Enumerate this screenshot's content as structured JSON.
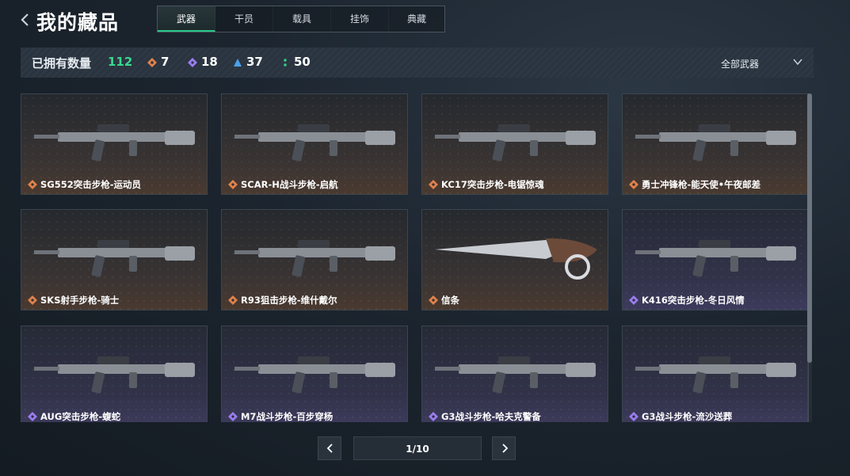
{
  "header": {
    "title": "我的藏品",
    "tabs": [
      {
        "label": "武器",
        "active": true
      },
      {
        "label": "干员",
        "active": false
      },
      {
        "label": "载具",
        "active": false
      },
      {
        "label": "挂饰",
        "active": false
      },
      {
        "label": "典藏",
        "active": false
      }
    ]
  },
  "stats": {
    "owned_label": "已拥有数量",
    "owned_count": "112",
    "rarity_counts": [
      {
        "icon": "orange-diamond-icon",
        "color": "#e0824a",
        "count": "7"
      },
      {
        "icon": "purple-diamond-icon",
        "color": "#9a7cf0",
        "count": "18"
      },
      {
        "icon": "blue-triangle-icon",
        "color": "#4a9fe8",
        "count": "37"
      },
      {
        "icon": "green-dots-icon",
        "color": "#34d08a",
        "count": "50"
      }
    ],
    "filter_label": "全部武器"
  },
  "items": [
    {
      "name": "SG552突击步枪-运动员",
      "rarity": "orange"
    },
    {
      "name": "SCAR-H战斗步枪-启航",
      "rarity": "orange"
    },
    {
      "name": "KC17突击步枪-电锯惊魂",
      "rarity": "orange"
    },
    {
      "name": "勇士冲锋枪-能天使•午夜邮差",
      "rarity": "orange"
    },
    {
      "name": "SKS射手步枪-骑士",
      "rarity": "orange"
    },
    {
      "name": "R93狙击步枪-维什戴尔",
      "rarity": "orange"
    },
    {
      "name": "信条",
      "rarity": "orange"
    },
    {
      "name": "K416突击步枪-冬日风情",
      "rarity": "purple"
    },
    {
      "name": "AUG突击步枪-蝮蛇",
      "rarity": "purple"
    },
    {
      "name": "M7战斗步枪-百步穿杨",
      "rarity": "purple"
    },
    {
      "name": "G3战斗步枪-哈夫克警备",
      "rarity": "purple"
    },
    {
      "name": "G3战斗步枪-流沙送葬",
      "rarity": "purple"
    }
  ],
  "pagination": {
    "text": "1/10"
  },
  "colors": {
    "accent_green": "#37d98d",
    "rarity_orange": "#e0824a",
    "rarity_purple": "#9a7cf0"
  }
}
